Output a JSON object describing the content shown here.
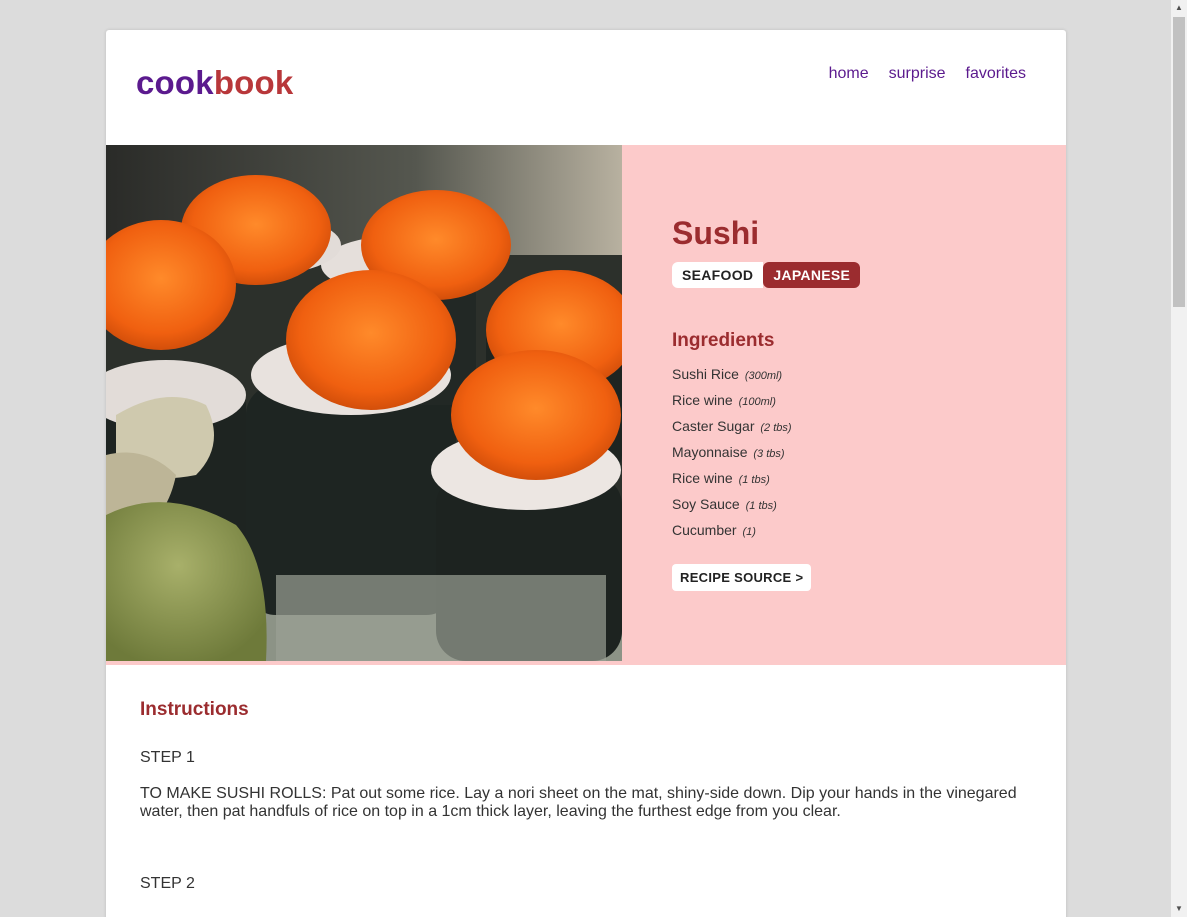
{
  "logo": {
    "part1": "cook",
    "part2": "book"
  },
  "nav": [
    {
      "label": "home"
    },
    {
      "label": "surprise"
    },
    {
      "label": "favorites"
    }
  ],
  "recipe": {
    "title": "Sushi",
    "tags": [
      "SEAFOOD",
      "JAPANESE"
    ],
    "ingredients_title": "Ingredients",
    "ingredients": [
      {
        "name": "Sushi Rice",
        "qty": "(300ml)"
      },
      {
        "name": "Rice wine",
        "qty": "(100ml)"
      },
      {
        "name": "Caster Sugar",
        "qty": "(2 tbs)"
      },
      {
        "name": "Mayonnaise",
        "qty": "(3 tbs)"
      },
      {
        "name": "Rice wine",
        "qty": "(1 tbs)"
      },
      {
        "name": "Soy Sauce",
        "qty": "(1 tbs)"
      },
      {
        "name": "Cucumber",
        "qty": "(1)"
      }
    ],
    "source_label": "RECIPE SOURCE >"
  },
  "instructions": {
    "title": "Instructions",
    "steps": [
      {
        "label": "STEP 1",
        "text": "TO MAKE SUSHI ROLLS: Pat out some rice. Lay a nori sheet on the mat, shiny-side down. Dip your hands in the vinegared water, then pat handfuls of rice on top in a 1cm thick layer, leaving the furthest edge from you clear."
      },
      {
        "label": "STEP 2",
        "text": ""
      }
    ]
  },
  "colors": {
    "brand_purple": "#5b1a8e",
    "brand_red": "#b8373a",
    "accent": "#9b2c2f",
    "hero_bg": "#fccaca"
  }
}
